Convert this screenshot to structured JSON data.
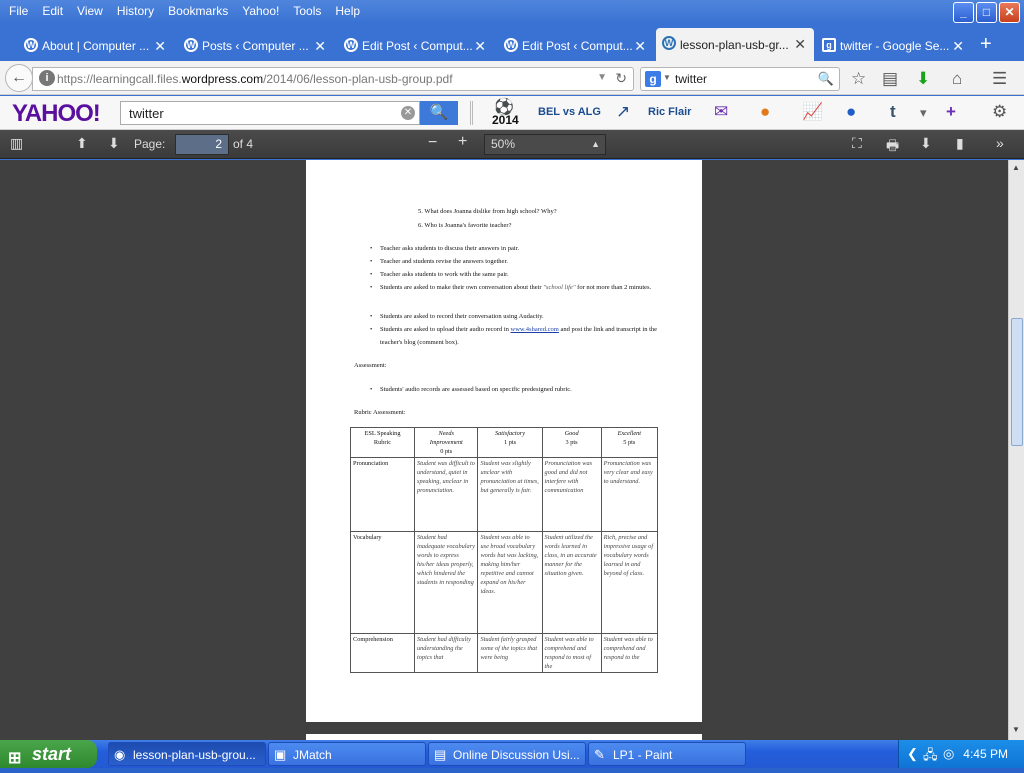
{
  "menu": [
    "File",
    "Edit",
    "View",
    "History",
    "Bookmarks",
    "Yahoo!",
    "Tools",
    "Help"
  ],
  "window_controls": {
    "minimize": "_",
    "maximize": "□",
    "close": "✕"
  },
  "tabs": [
    {
      "label": "About | Computer ..."
    },
    {
      "label": "Posts ‹ Computer ..."
    },
    {
      "label": "Edit Post ‹ Comput..."
    },
    {
      "label": "Edit Post ‹ Comput..."
    },
    {
      "label": "lesson-plan-usb-gr..."
    },
    {
      "label": "twitter - Google Se..."
    }
  ],
  "nav": {
    "url_prefix": "https://learningcall.files.",
    "url_domain": "wordpress.com",
    "url_suffix": "/2014/06/lesson-plan-usb-group.pdf",
    "search_value": "twitter"
  },
  "yahoo": {
    "logo": "YAHOO!",
    "search_value": "twitter",
    "badge_year": "2014",
    "item_match": "BEL vs ALG",
    "item_trend": "Ric Flair"
  },
  "pdf_toolbar": {
    "page_label": "Page:",
    "page_value": "2",
    "page_total": "of 4",
    "zoom": "50%"
  },
  "document": {
    "questions": [
      "5.   What does Joanna dislike from high school? Why?",
      "6.   Who is Joanna's favorite teacher?"
    ],
    "bullets": [
      "Teacher asks students to discuss their answers in pair.",
      "Teacher and students revise the answers together.",
      "Teacher asks students to work with the same pair.",
      "Students are asked to make their own conversation about their",
      "Students are asked to record their conversation using Audacity.",
      "Students are asked to upload their audio record in"
    ],
    "bullet4_italic": "\"school life\"",
    "bullet4_tail": "for not more than 2 minutes.",
    "bullet6_link": "www.4shared.com",
    "bullet6_tail": "and post the link and transcript in the teacher's blog (comment box).",
    "assessment_label": "Assessment:",
    "assessment_bullet": "Students' audio records are assessed based on specific predesigned rubric.",
    "rubric_label": "Rubric Assessment:",
    "rubric_headers": [
      {
        "l1": "ESL Speaking",
        "l2": "Rubric",
        "l3": ""
      },
      {
        "l1": "Needs",
        "l2": "Improvement",
        "l3": "0 pts"
      },
      {
        "l1": "Satisfactory",
        "l2": "1 pts",
        "l3": ""
      },
      {
        "l1": "Good",
        "l2": "3 pts",
        "l3": ""
      },
      {
        "l1": "Excellent",
        "l2": "5 pts",
        "l3": ""
      }
    ],
    "rubric_rows": [
      {
        "name": "Pronunciation",
        "cells": [
          "Student was difficult to understand, quiet in speaking, unclear in pronunciation.",
          "Student was slightly unclear with pronunciation at times, but generally is fair.",
          "Pronunciation was good and did not interfere with communication",
          "Pronunciation was very clear and easy to understand."
        ]
      },
      {
        "name": "Vocabulary",
        "cells": [
          "Student had inadequate vocabulary words to express his/her ideas properly, which hindered the students in responding",
          "Student was able to use broad vocabulary words but was lacking, making him/her repetitive and cannot expand on his/her ideas.",
          "Student utilized the words learned in class, in an accurate manner for the situation given.",
          "Rich, precise and impressive usage of vocabulary words learned in and beyond of class."
        ]
      },
      {
        "name": "Comprehension",
        "cells": [
          "Student had difficulty understanding the topics that",
          "Student fairly grasped some of the topics that were being",
          "Student was able to comprehend and respond to most of the",
          "Student was able to comprehend and respond to the"
        ]
      }
    ]
  },
  "taskbar": {
    "start": "start",
    "tasks": [
      {
        "label": "lesson-plan-usb-grou..."
      },
      {
        "label": "JMatch"
      },
      {
        "label": "Online Discussion Usi..."
      },
      {
        "label": "LP1 - Paint"
      }
    ],
    "clock": "4:45 PM"
  },
  "colors": {
    "yahoo_purple": "#5a0f9e",
    "xp_blue": "#245edb",
    "pdf_toolbar": "#3f3f3f"
  }
}
